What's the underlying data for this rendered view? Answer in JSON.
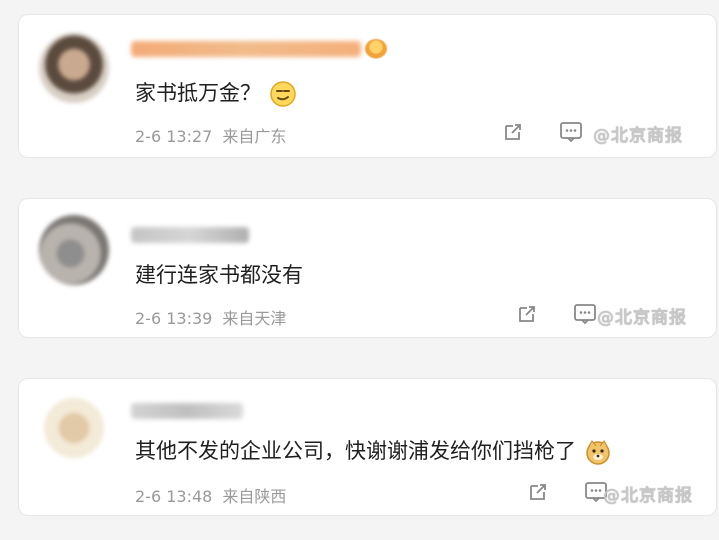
{
  "comments": [
    {
      "text": "家书抵万金？",
      "date": "2-6 13:27",
      "location": "来自广东",
      "emoji_icon": "smirk-face-emoji",
      "has_crown": true
    },
    {
      "text": "建行连家书都没有",
      "date": "2-6 13:39",
      "location": "来自天津",
      "emoji_icon": "",
      "has_crown": false
    },
    {
      "text": "其他不发的企业公司，快谢谢浦发给你们挡枪了",
      "date": "2-6 13:48",
      "location": "来自陕西",
      "emoji_icon": "doge-emoji",
      "has_crown": false
    }
  ],
  "watermark": "@北京商报",
  "colors": {
    "background": "#f4f4f4",
    "card": "#ffffff",
    "text": "#1f1f1f",
    "meta": "#9a9a9a"
  }
}
